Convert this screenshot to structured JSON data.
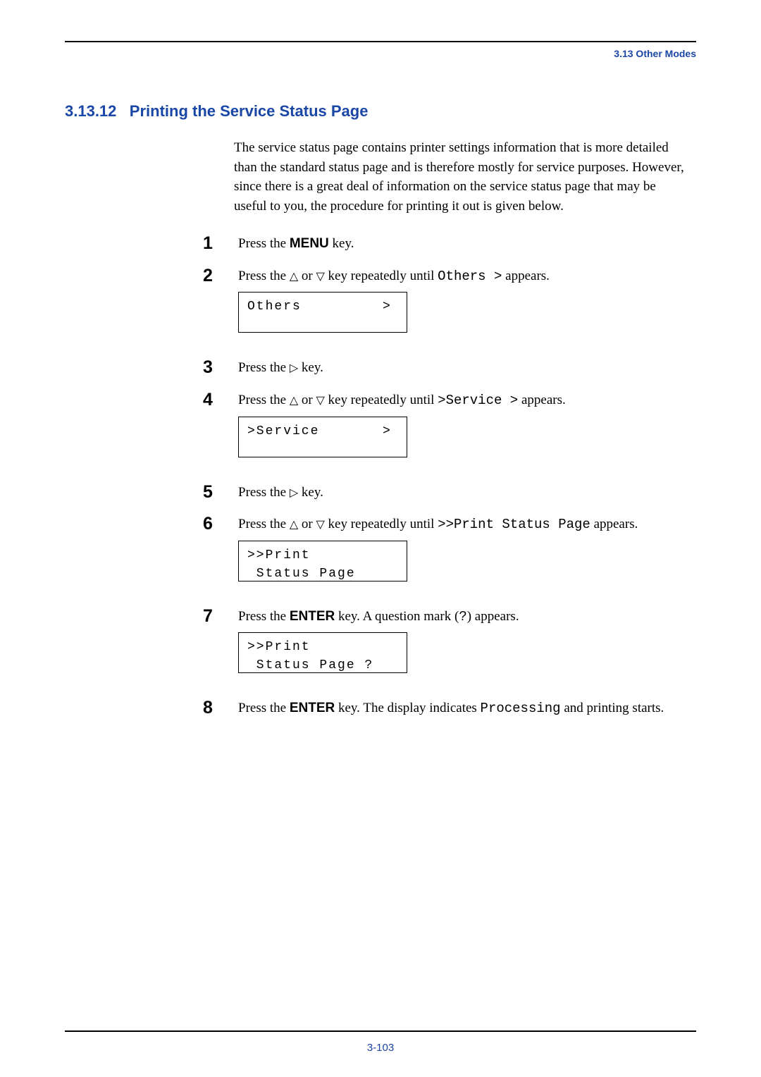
{
  "header": {
    "running_head": "3.13 Other Modes"
  },
  "section": {
    "number": "3.13.12",
    "title": "Printing the Service Status Page"
  },
  "intro": "The service status page contains printer settings information that is more detailed than the standard status page and is therefore mostly for service purposes. However, since there is a great deal of information on the service status page that may be useful to you, the procedure for printing it out is given below.",
  "steps": {
    "s1": {
      "num": "1",
      "press": "Press the ",
      "key": "MENU",
      "after": " key."
    },
    "s2": {
      "num": "2",
      "text_a": "Press the ",
      "text_b": " or ",
      "text_c": " key repeatedly until ",
      "code": "Others >",
      "text_d": " appears.",
      "lcd": "Others         >"
    },
    "s3": {
      "num": "3",
      "text_a": "Press the ",
      "text_b": " key."
    },
    "s4": {
      "num": "4",
      "text_a": "Press the ",
      "text_b": " or ",
      "text_c": " key repeatedly until ",
      "code": ">Service >",
      "text_d": " appears.",
      "lcd": ">Service       >"
    },
    "s5": {
      "num": "5",
      "text_a": "Press the ",
      "text_b": " key."
    },
    "s6": {
      "num": "6",
      "text_a": "Press the ",
      "text_b": " or ",
      "text_c": " key repeatedly until ",
      "code": ">>Print Status Page",
      "text_d": " appears.",
      "lcd": ">>Print\n Status Page"
    },
    "s7": {
      "num": "7",
      "text_a": "Press the ",
      "key": "ENTER",
      "text_b": " key. A question mark (",
      "code": "?",
      "text_c": ") appears.",
      "lcd": ">>Print\n Status Page ?"
    },
    "s8": {
      "num": "8",
      "text_a": "Press the ",
      "key": "ENTER",
      "text_b": " key. The display indicates ",
      "code": "Processing",
      "text_c": " and printing starts."
    }
  },
  "pageNumber": "3-103",
  "glyphs": {
    "triUp": "△",
    "triDown": "▽",
    "triRight": "▷"
  }
}
